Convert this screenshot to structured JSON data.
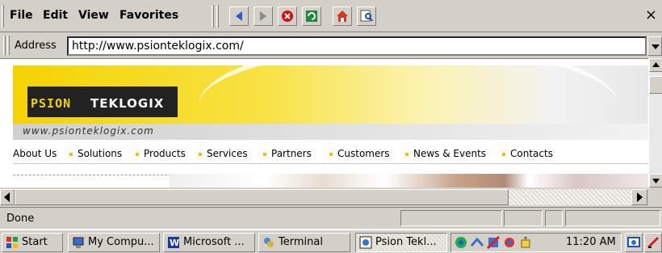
{
  "menu": {
    "file": "File",
    "edit": "Edit",
    "view": "View",
    "favorites": "Favorites",
    "close": "×"
  },
  "toolbar": {
    "buttons": [
      "back-icon",
      "forward-icon",
      "stop-icon",
      "refresh-icon",
      "home-icon",
      "search-icon"
    ]
  },
  "address": {
    "label": "Address",
    "url": "http://www.psionteklogix.com/"
  },
  "page": {
    "logo_psion": "PSION",
    "logo_teklogix": "TEKLOGIX",
    "site_url": "www.psionteklogix.com",
    "nav": [
      "About Us",
      "Solutions",
      "Products",
      "Services",
      "Partners",
      "Customers",
      "News & Events",
      "Contacts"
    ],
    "brand_color": "#f4d300"
  },
  "status": {
    "text": "Done"
  },
  "taskbar": {
    "start": "Start",
    "items": [
      "My Compu...",
      "Microsoft ...",
      "Terminal",
      "Psion Tekl..."
    ],
    "active_index": 3,
    "clock": "11:20 AM"
  }
}
